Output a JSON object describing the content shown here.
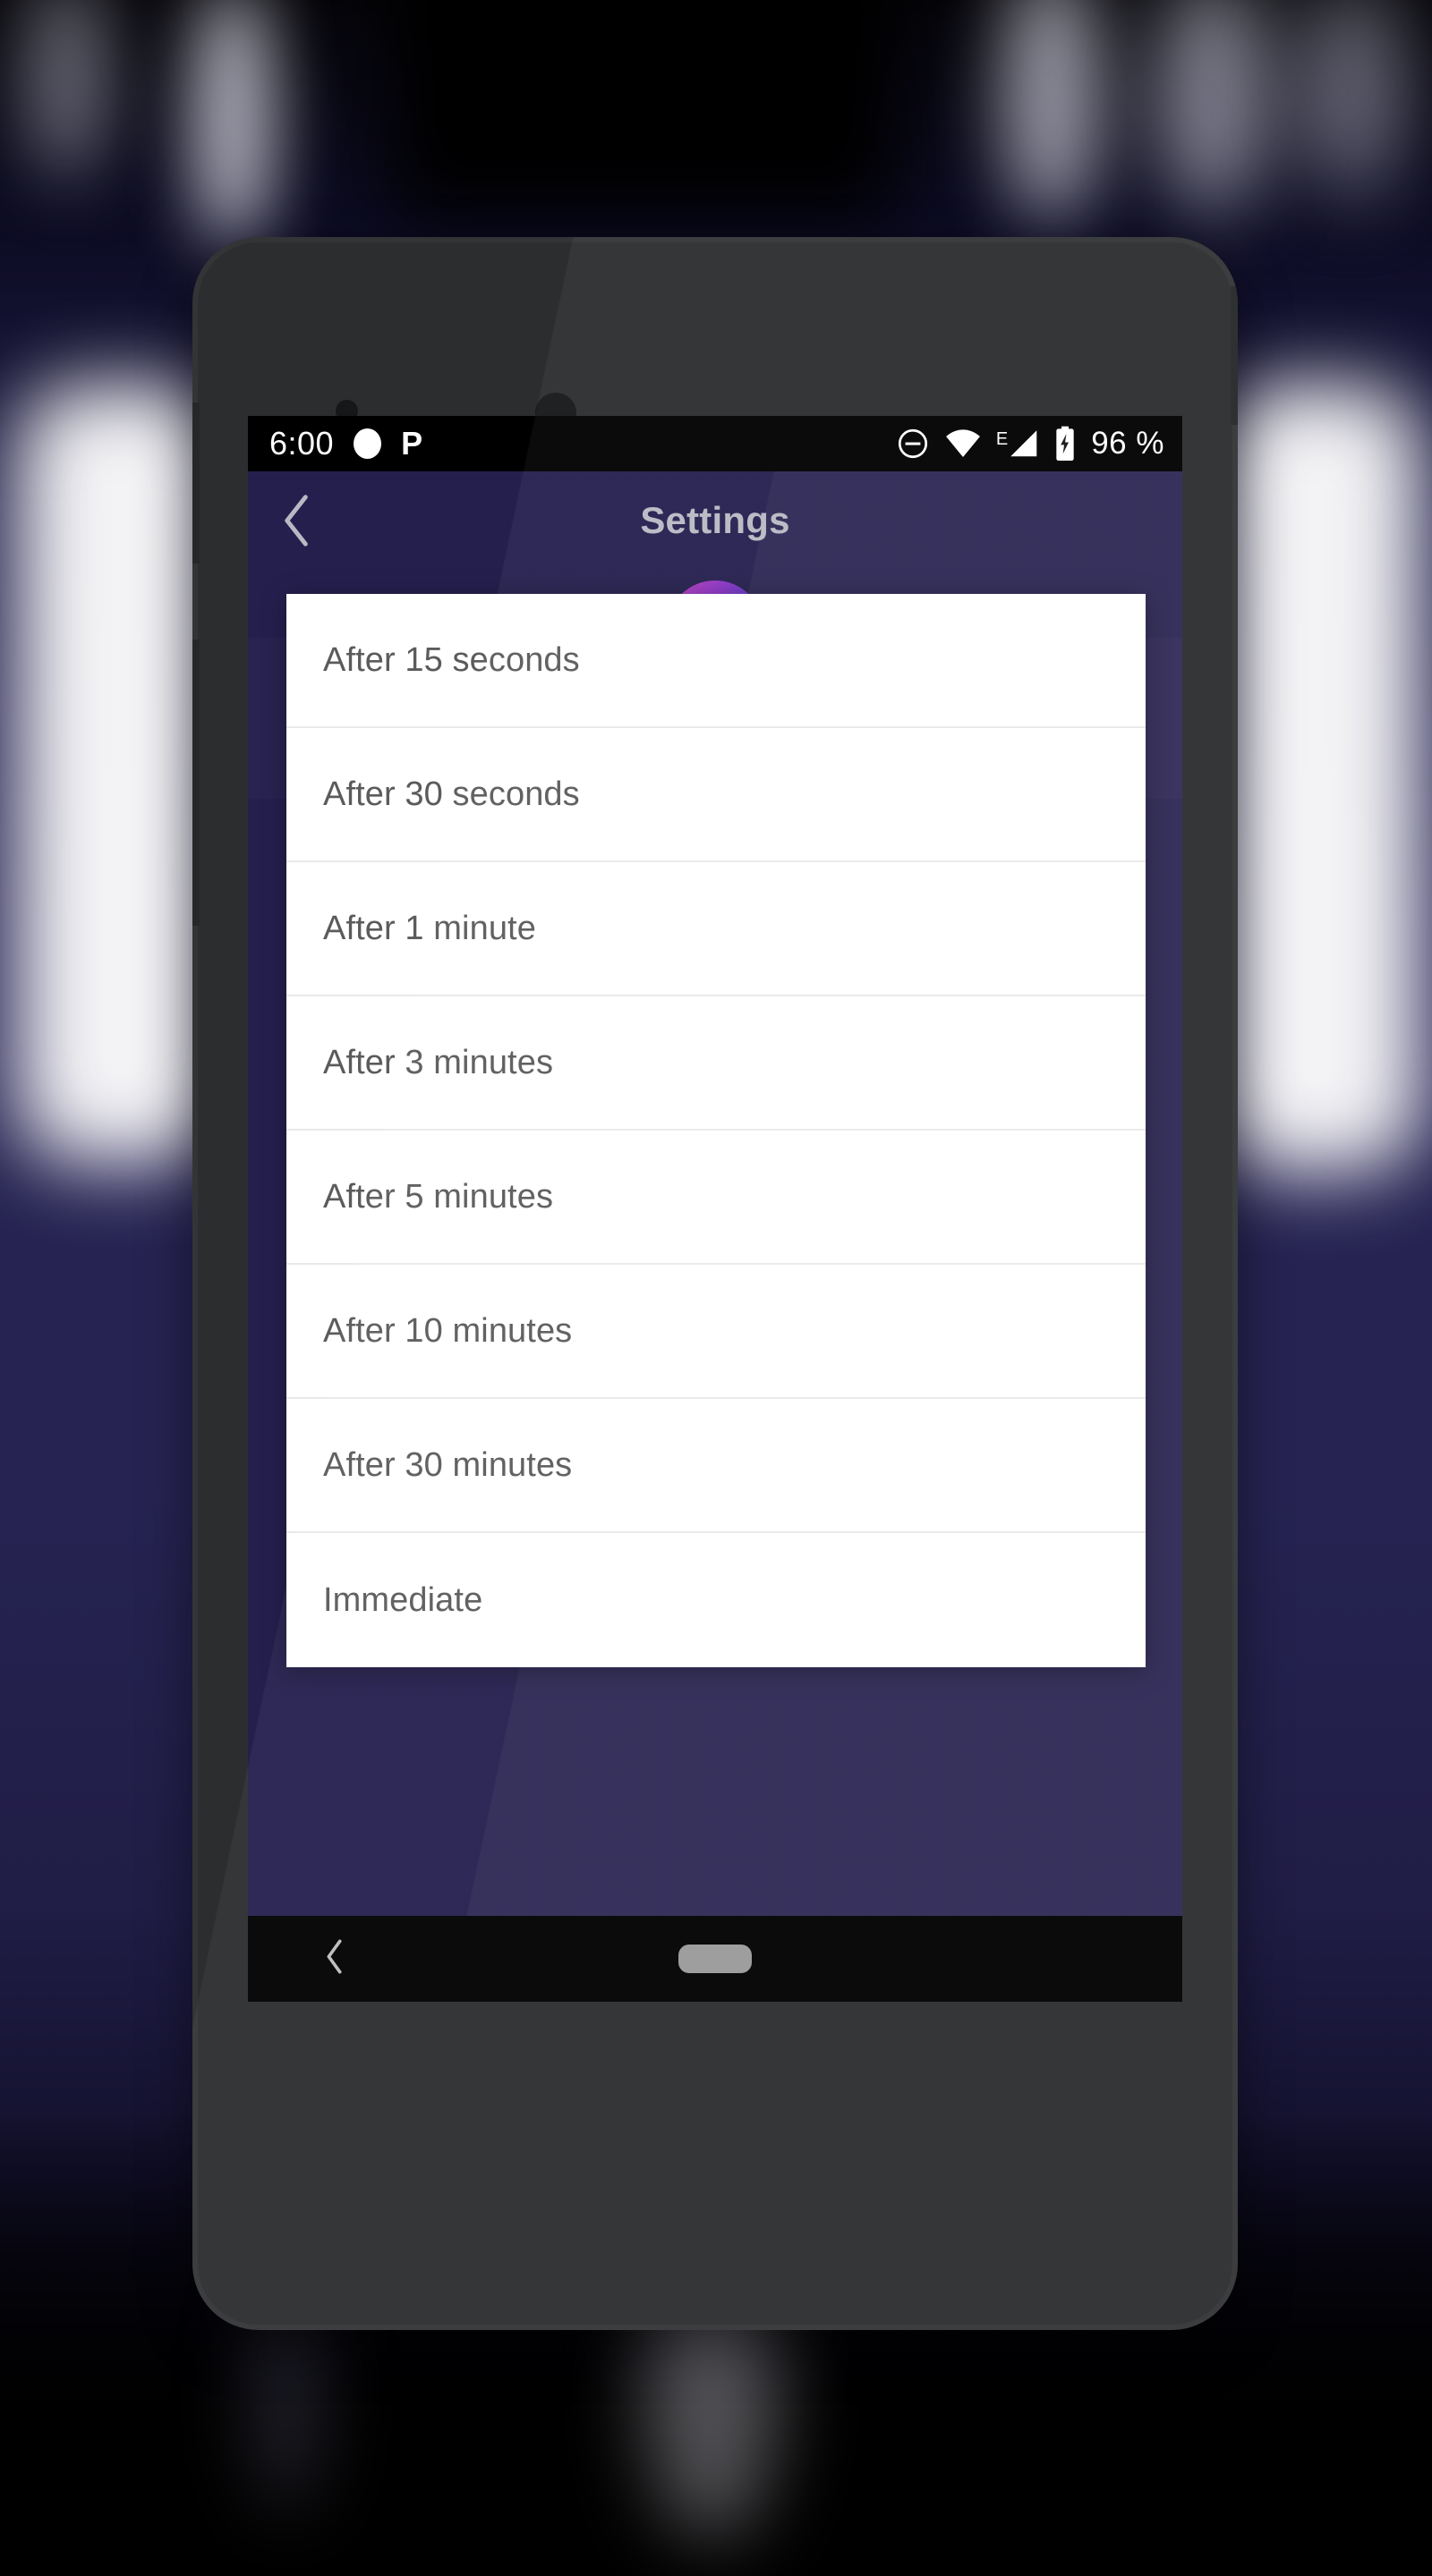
{
  "background": {
    "description": "blurred dark navy purple scene with white vertical light glows on both sides"
  },
  "device": {
    "frame_color": "#333436",
    "camera_small": "front-camera-dot",
    "camera_large": "speaker-sensor-dot"
  },
  "status_bar": {
    "time": "6:00",
    "left_icons": [
      "notification-dot-icon",
      "parking-p-icon"
    ],
    "right_icons": [
      "do-not-disturb-icon",
      "wifi-icon",
      "cellular-signal-icon",
      "battery-charging-icon"
    ],
    "network_type": "E",
    "battery_text": "96 %",
    "background": "#000000"
  },
  "app": {
    "accent_bg": "#251f4e",
    "back_icon": "chevron-left-icon",
    "title": "Settings",
    "app_icon": "shield-check-icon",
    "app_icon_gradient": [
      "#c43fbf",
      "#1558c0"
    ]
  },
  "dialog": {
    "name": "auto-lock-timeout-chooser",
    "items": [
      {
        "label": "After 15 seconds"
      },
      {
        "label": "After 30 seconds"
      },
      {
        "label": "After 1 minute"
      },
      {
        "label": "After 3 minutes"
      },
      {
        "label": "After 5 minutes"
      },
      {
        "label": "After 10 minutes"
      },
      {
        "label": "After 30 minutes"
      },
      {
        "label": "Immediate"
      }
    ],
    "text_color": "#5b5b5b",
    "divider_color": "#e9e9e9",
    "background": "#ffffff"
  },
  "nav_bar": {
    "back_icon": "chevron-left-icon",
    "home_pill": "home-pill-icon",
    "background": "#000000"
  }
}
